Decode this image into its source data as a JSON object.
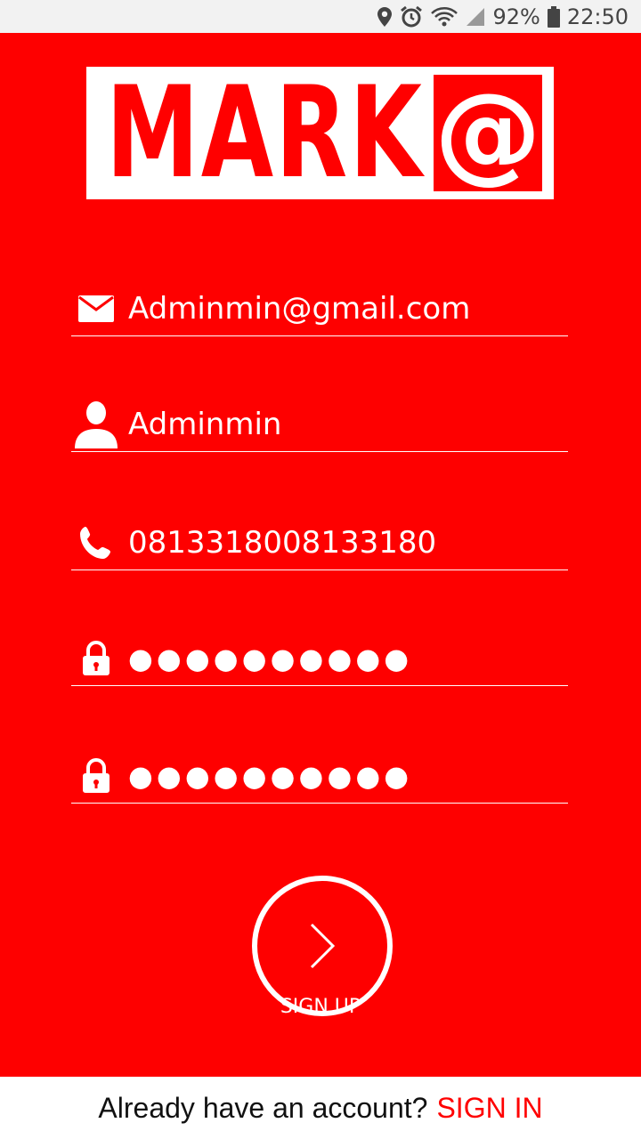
{
  "status": {
    "battery": "92%",
    "time": "22:50"
  },
  "logo": {
    "text": "MARK",
    "symbol": "@"
  },
  "form": {
    "email": "Adminmin@gmail.com",
    "username": "Adminmin",
    "phone": "0813318008133180",
    "password": "●●●●●●●●●●",
    "confirm_password": "●●●●●●●●●●"
  },
  "signup_label": "SIGN UP",
  "footer": {
    "question": "Already have an account?",
    "link": "SIGN IN"
  },
  "colors": {
    "brand": "#fe0000",
    "text_on_brand": "#ffffff"
  },
  "icons": [
    "location-icon",
    "alarm-icon",
    "wifi-icon",
    "signal-icon",
    "battery-icon",
    "mail-icon",
    "person-icon",
    "phone-icon",
    "lock-icon",
    "chevron-right-icon"
  ]
}
